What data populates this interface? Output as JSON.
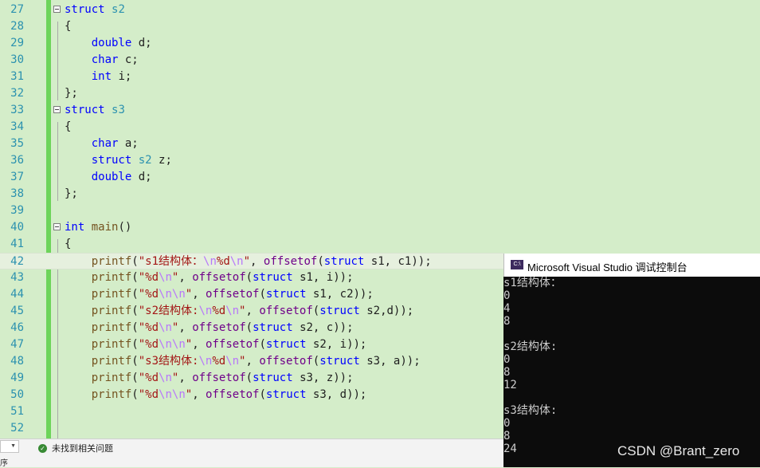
{
  "editor": {
    "lines": [
      {
        "n": "27",
        "tokens": [
          [
            "kw",
            "struct"
          ],
          [
            "pl",
            " "
          ],
          [
            "ty",
            "s2"
          ]
        ]
      },
      {
        "n": "28",
        "tokens": [
          [
            "pl",
            "{"
          ]
        ]
      },
      {
        "n": "29",
        "tokens": [
          [
            "pl",
            "    "
          ],
          [
            "kw",
            "double"
          ],
          [
            "pl",
            " d;"
          ]
        ]
      },
      {
        "n": "30",
        "tokens": [
          [
            "pl",
            "    "
          ],
          [
            "kw",
            "char"
          ],
          [
            "pl",
            " c;"
          ]
        ]
      },
      {
        "n": "31",
        "tokens": [
          [
            "pl",
            "    "
          ],
          [
            "kw",
            "int"
          ],
          [
            "pl",
            " i;"
          ]
        ]
      },
      {
        "n": "32",
        "tokens": [
          [
            "pl",
            "};"
          ]
        ]
      },
      {
        "n": "33",
        "tokens": [
          [
            "kw",
            "struct"
          ],
          [
            "pl",
            " "
          ],
          [
            "ty",
            "s3"
          ]
        ]
      },
      {
        "n": "34",
        "tokens": [
          [
            "pl",
            "{"
          ]
        ]
      },
      {
        "n": "35",
        "tokens": [
          [
            "pl",
            "    "
          ],
          [
            "kw",
            "char"
          ],
          [
            "pl",
            " a;"
          ]
        ]
      },
      {
        "n": "36",
        "tokens": [
          [
            "pl",
            "    "
          ],
          [
            "kw",
            "struct"
          ],
          [
            "pl",
            " "
          ],
          [
            "ty",
            "s2"
          ],
          [
            "pl",
            " z;"
          ]
        ]
      },
      {
        "n": "37",
        "tokens": [
          [
            "pl",
            "    "
          ],
          [
            "kw",
            "double"
          ],
          [
            "pl",
            " d;"
          ]
        ]
      },
      {
        "n": "38",
        "tokens": [
          [
            "pl",
            "};"
          ]
        ]
      },
      {
        "n": "39",
        "tokens": []
      },
      {
        "n": "40",
        "tokens": [
          [
            "kw",
            "int"
          ],
          [
            "pl",
            " "
          ],
          [
            "fn",
            "main"
          ],
          [
            "pl",
            "()"
          ]
        ]
      },
      {
        "n": "41",
        "tokens": [
          [
            "pl",
            "{"
          ]
        ]
      },
      {
        "n": "42",
        "tokens": [
          [
            "pl",
            "    "
          ],
          [
            "fn",
            "printf"
          ],
          [
            "pl",
            "("
          ],
          [
            "str",
            "\"s1结构体："
          ],
          [
            "esc",
            "\\n"
          ],
          [
            "str",
            "%d"
          ],
          [
            "esc",
            "\\n"
          ],
          [
            "str",
            "\""
          ],
          [
            "pl",
            ", "
          ],
          [
            "mac",
            "offsetof"
          ],
          [
            "pl",
            "("
          ],
          [
            "kw",
            "struct"
          ],
          [
            "pl",
            " s1, c1));"
          ]
        ]
      },
      {
        "n": "43",
        "tokens": [
          [
            "pl",
            "    "
          ],
          [
            "fn",
            "printf"
          ],
          [
            "pl",
            "("
          ],
          [
            "str",
            "\"%d"
          ],
          [
            "esc",
            "\\n"
          ],
          [
            "str",
            "\""
          ],
          [
            "pl",
            ", "
          ],
          [
            "mac",
            "offsetof"
          ],
          [
            "pl",
            "("
          ],
          [
            "kw",
            "struct"
          ],
          [
            "pl",
            " s1, i));"
          ]
        ]
      },
      {
        "n": "44",
        "tokens": [
          [
            "pl",
            "    "
          ],
          [
            "fn",
            "printf"
          ],
          [
            "pl",
            "("
          ],
          [
            "str",
            "\"%d"
          ],
          [
            "esc",
            "\\n\\n"
          ],
          [
            "str",
            "\""
          ],
          [
            "pl",
            ", "
          ],
          [
            "mac",
            "offsetof"
          ],
          [
            "pl",
            "("
          ],
          [
            "kw",
            "struct"
          ],
          [
            "pl",
            " s1, c2));"
          ]
        ]
      },
      {
        "n": "45",
        "tokens": [
          [
            "pl",
            "    "
          ],
          [
            "fn",
            "printf"
          ],
          [
            "pl",
            "("
          ],
          [
            "str",
            "\"s2结构体:"
          ],
          [
            "esc",
            "\\n"
          ],
          [
            "str",
            "%d"
          ],
          [
            "esc",
            "\\n"
          ],
          [
            "str",
            "\""
          ],
          [
            "pl",
            ", "
          ],
          [
            "mac",
            "offsetof"
          ],
          [
            "pl",
            "("
          ],
          [
            "kw",
            "struct"
          ],
          [
            "pl",
            " s2,d));"
          ]
        ]
      },
      {
        "n": "46",
        "tokens": [
          [
            "pl",
            "    "
          ],
          [
            "fn",
            "printf"
          ],
          [
            "pl",
            "("
          ],
          [
            "str",
            "\"%d"
          ],
          [
            "esc",
            "\\n"
          ],
          [
            "str",
            "\""
          ],
          [
            "pl",
            ", "
          ],
          [
            "mac",
            "offsetof"
          ],
          [
            "pl",
            "("
          ],
          [
            "kw",
            "struct"
          ],
          [
            "pl",
            " s2, c));"
          ]
        ]
      },
      {
        "n": "47",
        "tokens": [
          [
            "pl",
            "    "
          ],
          [
            "fn",
            "printf"
          ],
          [
            "pl",
            "("
          ],
          [
            "str",
            "\"%d"
          ],
          [
            "esc",
            "\\n\\n"
          ],
          [
            "str",
            "\""
          ],
          [
            "pl",
            ", "
          ],
          [
            "mac",
            "offsetof"
          ],
          [
            "pl",
            "("
          ],
          [
            "kw",
            "struct"
          ],
          [
            "pl",
            " s2, i));"
          ]
        ]
      },
      {
        "n": "48",
        "tokens": [
          [
            "pl",
            "    "
          ],
          [
            "fn",
            "printf"
          ],
          [
            "pl",
            "("
          ],
          [
            "str",
            "\"s3结构体:"
          ],
          [
            "esc",
            "\\n"
          ],
          [
            "str",
            "%d"
          ],
          [
            "esc",
            "\\n"
          ],
          [
            "str",
            "\""
          ],
          [
            "pl",
            ", "
          ],
          [
            "mac",
            "offsetof"
          ],
          [
            "pl",
            "("
          ],
          [
            "kw",
            "struct"
          ],
          [
            "pl",
            " s3, a));"
          ]
        ]
      },
      {
        "n": "49",
        "tokens": [
          [
            "pl",
            "    "
          ],
          [
            "fn",
            "printf"
          ],
          [
            "pl",
            "("
          ],
          [
            "str",
            "\"%d"
          ],
          [
            "esc",
            "\\n"
          ],
          [
            "str",
            "\""
          ],
          [
            "pl",
            ", "
          ],
          [
            "mac",
            "offsetof"
          ],
          [
            "pl",
            "("
          ],
          [
            "kw",
            "struct"
          ],
          [
            "pl",
            " s3, z));"
          ]
        ]
      },
      {
        "n": "50",
        "tokens": [
          [
            "pl",
            "    "
          ],
          [
            "fn",
            "printf"
          ],
          [
            "pl",
            "("
          ],
          [
            "str",
            "\"%d"
          ],
          [
            "esc",
            "\\n\\n"
          ],
          [
            "str",
            "\""
          ],
          [
            "pl",
            ", "
          ],
          [
            "mac",
            "offsetof"
          ],
          [
            "pl",
            "("
          ],
          [
            "kw",
            "struct"
          ],
          [
            "pl",
            " s3, d));"
          ]
        ]
      },
      {
        "n": "51",
        "tokens": []
      },
      {
        "n": "52",
        "tokens": []
      }
    ]
  },
  "status": {
    "message": "未找到相关问题",
    "bottom_fragment": "序"
  },
  "console": {
    "title": "Microsoft Visual Studio 调试控制台",
    "icon_text": "C:\\",
    "lines": [
      "s1结构体：",
      "0",
      "4",
      "8",
      "",
      "s2结构体:",
      "0",
      "8",
      "12",
      "",
      "s3结构体:",
      "0",
      "8",
      "24"
    ]
  },
  "watermark": "CSDN @Brant_zero",
  "colors": {
    "editor_bg": "#d4edc9",
    "line_number": "#2b91af",
    "keyword": "#0000ff",
    "string": "#a31515",
    "change_bar": "#6dd45a",
    "console_bg": "#0c0c0c"
  }
}
